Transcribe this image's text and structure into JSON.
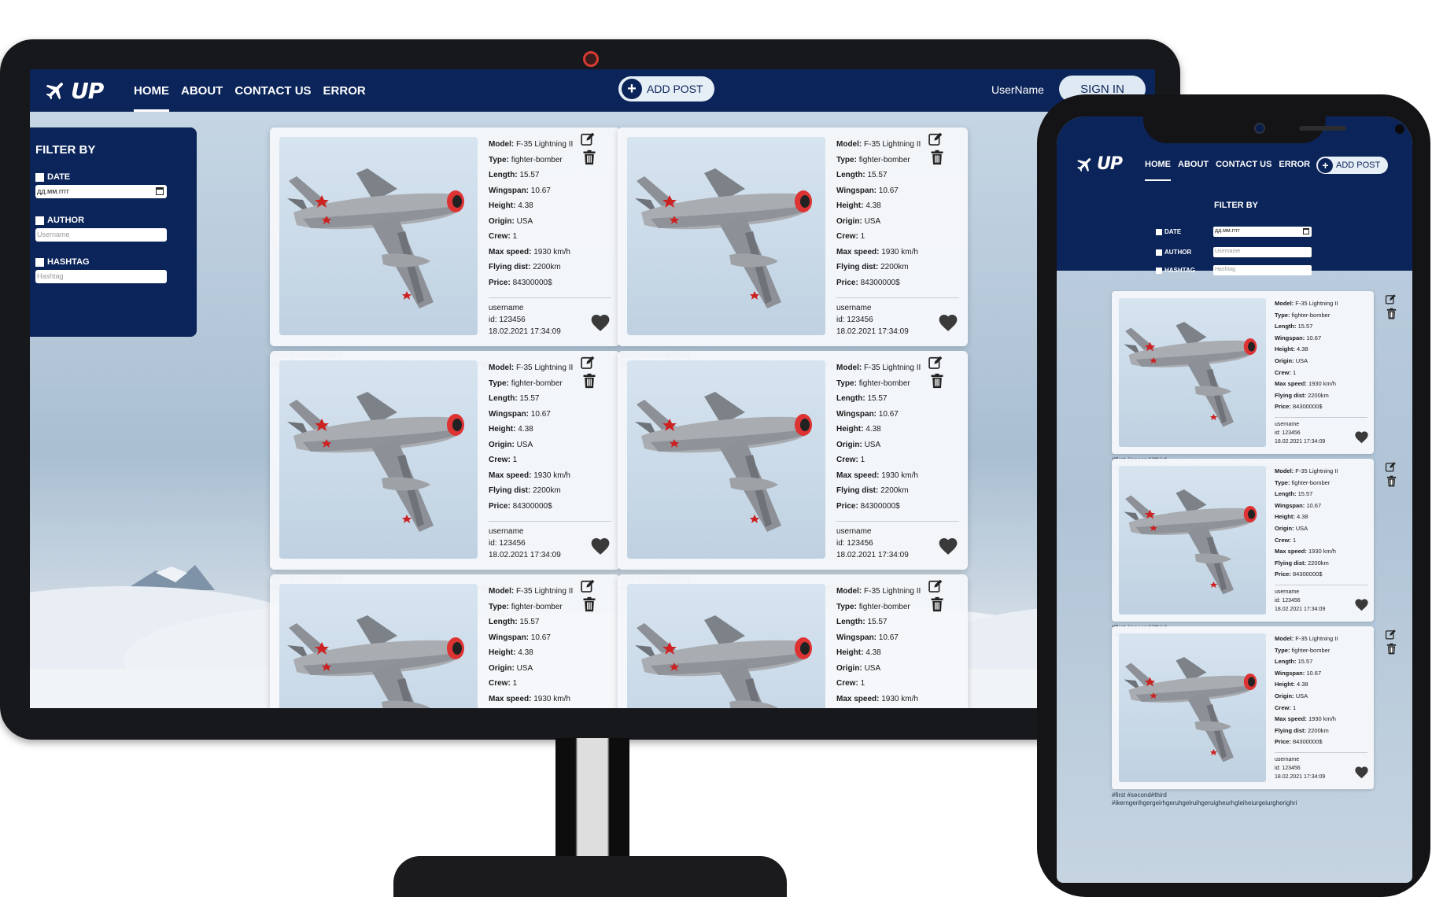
{
  "monitor": {
    "nav": [
      "HOME",
      "ABOUT",
      "CONTACT US",
      "ERROR"
    ],
    "active_nav": "HOME",
    "add_post_label": "ADD POST",
    "username": "UserName",
    "sign_in_label": "SIGN IN",
    "logo_text": "UP",
    "filter": {
      "title": "FILTER BY",
      "date_label": "DATE",
      "date_value": "дд.мм.гггг",
      "author_label": "AUTHOR",
      "author_placeholder": "Username",
      "hashtag_label": "HASHTAG",
      "hashtag_placeholder": "Hashtag"
    }
  },
  "phone": {
    "nav": [
      "HOME",
      "ABOUT",
      "CONTACT US",
      "ERROR"
    ],
    "add_post_label": "ADD POST",
    "logo_text": "UP",
    "filter": {
      "title": "FILTER BY",
      "date_label": "DATE",
      "date_value": "дд.мм.гггг",
      "author_label": "AUTHOR",
      "author_placeholder": "Username",
      "hashtag_label": "HASHTAG",
      "hashtag_placeholder": "Hashtag"
    }
  },
  "post": {
    "specs": [
      {
        "label": "Model:",
        "value": "F-35 Lightning II"
      },
      {
        "label": "Type:",
        "value": "fighter-bomber"
      },
      {
        "label": "Length:",
        "value": "15.57"
      },
      {
        "label": "Wingspan:",
        "value": "10.67"
      },
      {
        "label": "Height:",
        "value": "4.38"
      },
      {
        "label": "Origin:",
        "value": "USA"
      },
      {
        "label": "Crew:",
        "value": "1"
      },
      {
        "label": "Max speed:",
        "value": "1930 km/h"
      },
      {
        "label": "Flying dist:",
        "value": "2200km"
      },
      {
        "label": "Price:",
        "value": "84300000$"
      }
    ],
    "author": "username",
    "id": "id: 123456",
    "date": "18.02.2021 17:34:09",
    "tags_line1": "#first #second#third",
    "tags_line2": "#ikerngerihgergeirhgeruhgelruihgeruigheurhgleiheiurgeiurgherighri"
  },
  "icons": {
    "edit": "edit-icon",
    "delete": "trash-icon",
    "like": "heart-icon",
    "add": "plus-icon",
    "calendar": "calendar-icon",
    "logo": "airplane-icon"
  },
  "colors": {
    "header": "#0b2459",
    "button_bg": "#e6eef6"
  }
}
